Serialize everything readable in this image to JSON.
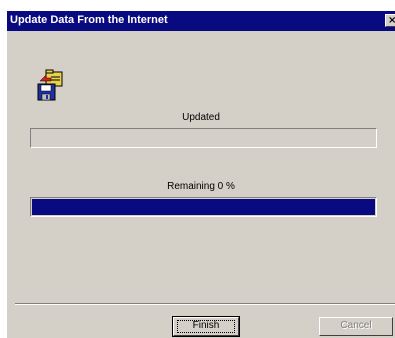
{
  "window": {
    "title": "Update Data From the Internet",
    "close_glyph": "×"
  },
  "icons": {
    "app": "disk-folder-icon",
    "close": "close-icon"
  },
  "progress": {
    "updated_label": "Updated",
    "updated_fraction": 0,
    "remaining_label": "Remaining 0 %",
    "remaining_fraction": 1
  },
  "buttons": {
    "finish_label": "Finish",
    "cancel_label": "Cancel"
  },
  "colors": {
    "title_bar": "#0a0a80",
    "progress_fill": "#0a0a80",
    "face": "#d4d0c8"
  }
}
